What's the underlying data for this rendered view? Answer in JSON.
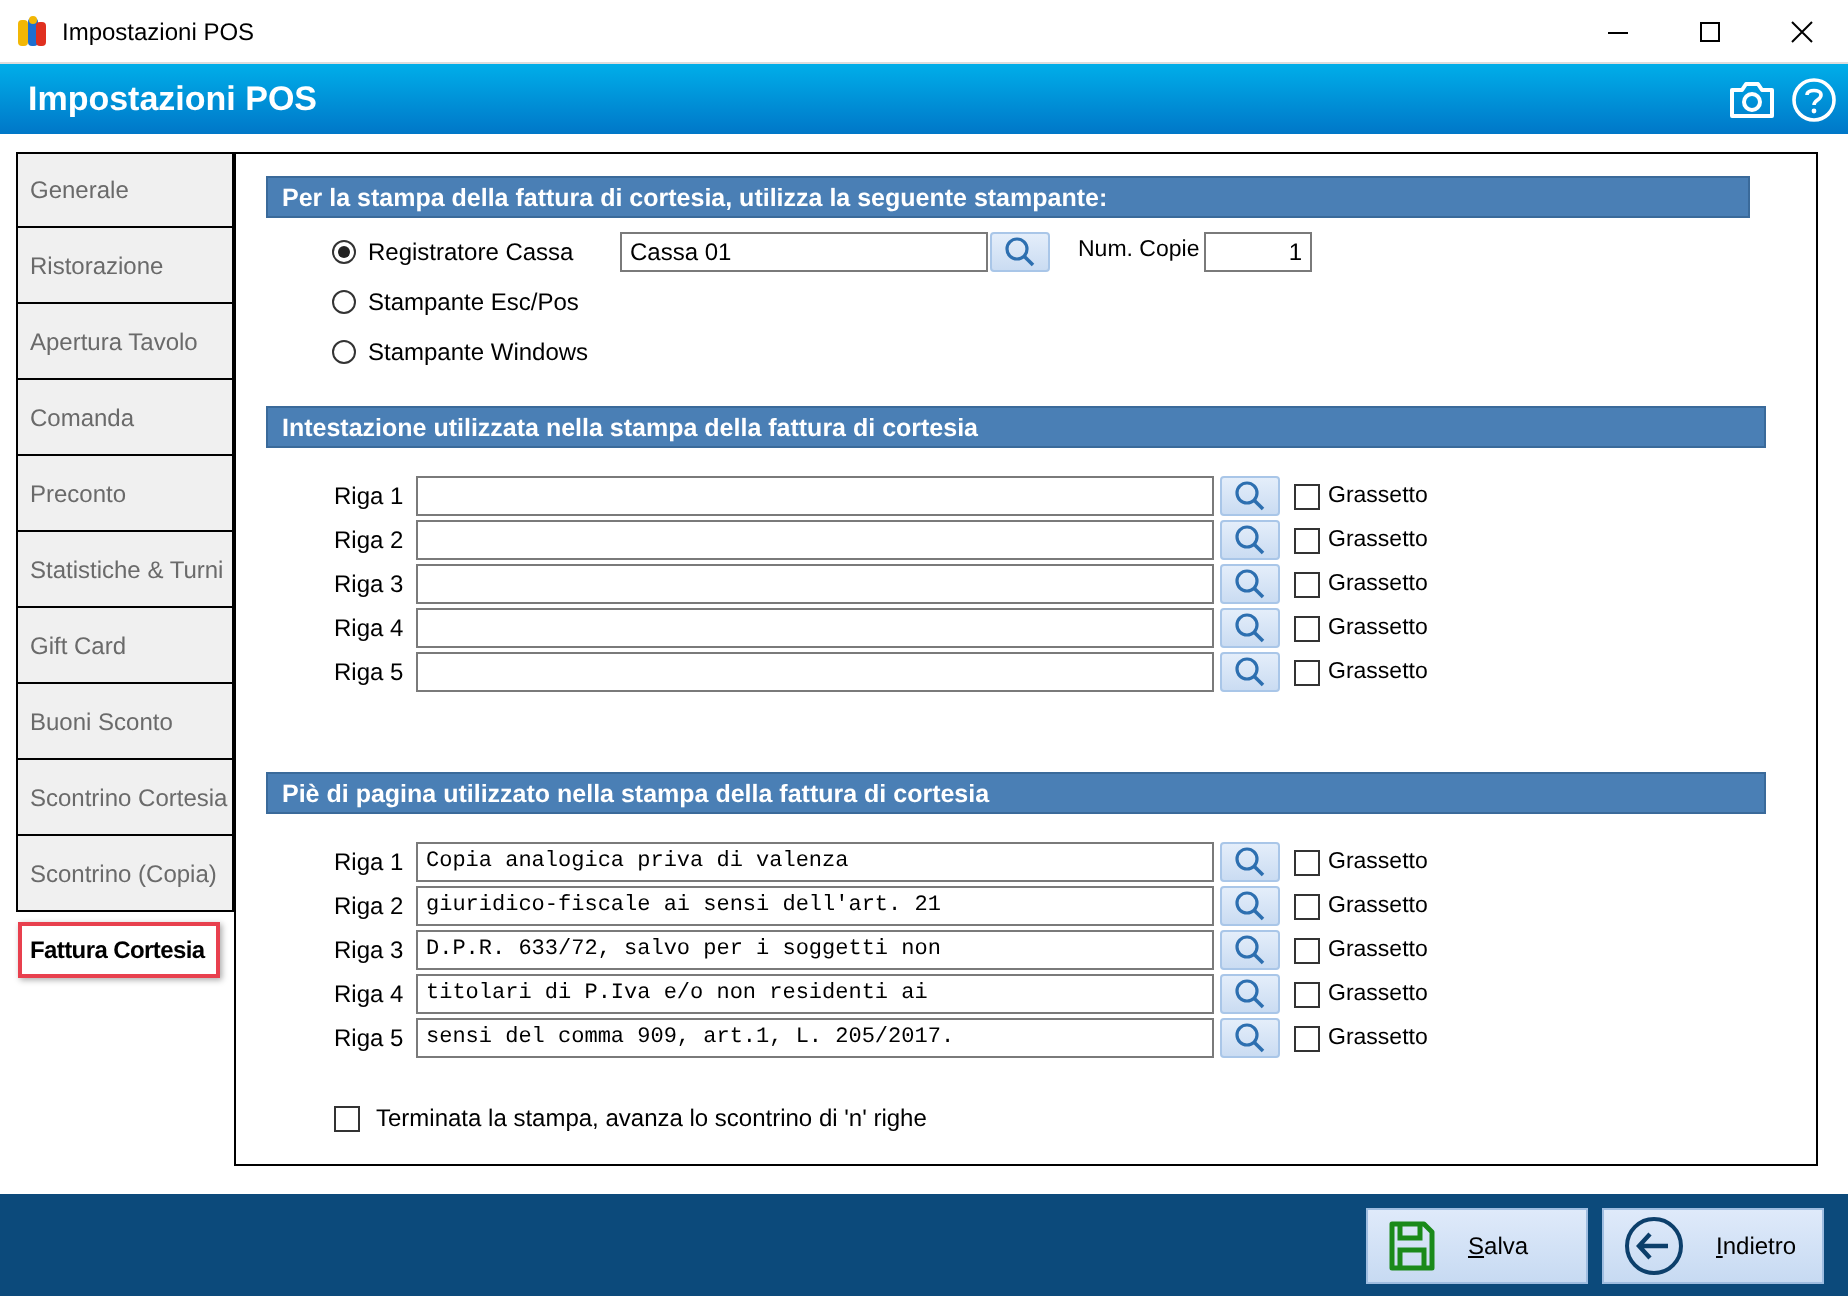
{
  "window": {
    "title": "Impostazioni POS"
  },
  "header": {
    "title": "Impostazioni POS"
  },
  "tabs": [
    {
      "label": "Generale",
      "selected": false
    },
    {
      "label": "Ristorazione",
      "selected": false
    },
    {
      "label": "Apertura Tavolo",
      "selected": false
    },
    {
      "label": "Comanda",
      "selected": false
    },
    {
      "label": "Preconto",
      "selected": false
    },
    {
      "label": "Statistiche & Turni",
      "selected": false
    },
    {
      "label": "Gift Card",
      "selected": false
    },
    {
      "label": "Buoni Sconto",
      "selected": false
    },
    {
      "label": "Scontrino Cortesia",
      "selected": false
    },
    {
      "label": "Scontrino (Copia)",
      "selected": false
    },
    {
      "label": "Fattura Cortesia",
      "selected": true
    }
  ],
  "printer_section": {
    "title": "Per la stampa della fattura di cortesia, utilizza la seguente stampante:",
    "options": [
      {
        "label": "Registratore Cassa",
        "selected": true
      },
      {
        "label": "Stampante Esc/Pos",
        "selected": false
      },
      {
        "label": "Stampante Windows",
        "selected": false
      }
    ],
    "printer_field": {
      "value": "Cassa 01"
    },
    "copies": {
      "label": "Num. Copie",
      "value": "1"
    }
  },
  "header_section": {
    "title": "Intestazione utilizzata nella stampa della fattura di cortesia",
    "rows": [
      {
        "label": "Riga 1",
        "bold_label": "Grassetto",
        "checked": false
      },
      {
        "label": "Riga 2",
        "bold_label": "Grassetto",
        "checked": false
      },
      {
        "label": "Riga 3",
        "bold_label": "Grassetto",
        "checked": false
      },
      {
        "label": "Riga 4",
        "bold_label": "Grassetto",
        "checked": false
      },
      {
        "label": "Riga 5",
        "bold_label": "Grassetto",
        "checked": false
      }
    ]
  },
  "footer_section": {
    "title": "Piè di pagina utilizzato nella stampa della fattura di cortesia",
    "rows": [
      {
        "label": "Riga 1",
        "value": "Copia analogica priva di valenza",
        "bold_label": "Grassetto",
        "checked": false
      },
      {
        "label": "Riga 2",
        "value": "giuridico-fiscale ai sensi dell'art. 21",
        "bold_label": "Grassetto",
        "checked": false
      },
      {
        "label": "Riga 3",
        "value": "D.P.R. 633/72, salvo per i soggetti non",
        "bold_label": "Grassetto",
        "checked": false
      },
      {
        "label": "Riga 4",
        "value": "titolari di P.Iva e/o non residenti ai",
        "bold_label": "Grassetto",
        "checked": false
      },
      {
        "label": "Riga 5",
        "value": "sensi del comma 909, art.1, L. 205/2017.",
        "bold_label": "Grassetto",
        "checked": false
      }
    ]
  },
  "advance_option": {
    "label": "Terminata la stampa, avanza lo scontrino di 'n' righe",
    "checked": false
  },
  "buttons": [
    {
      "label": "Salva",
      "kind": "save"
    },
    {
      "label": "Indietro",
      "kind": "back"
    }
  ]
}
